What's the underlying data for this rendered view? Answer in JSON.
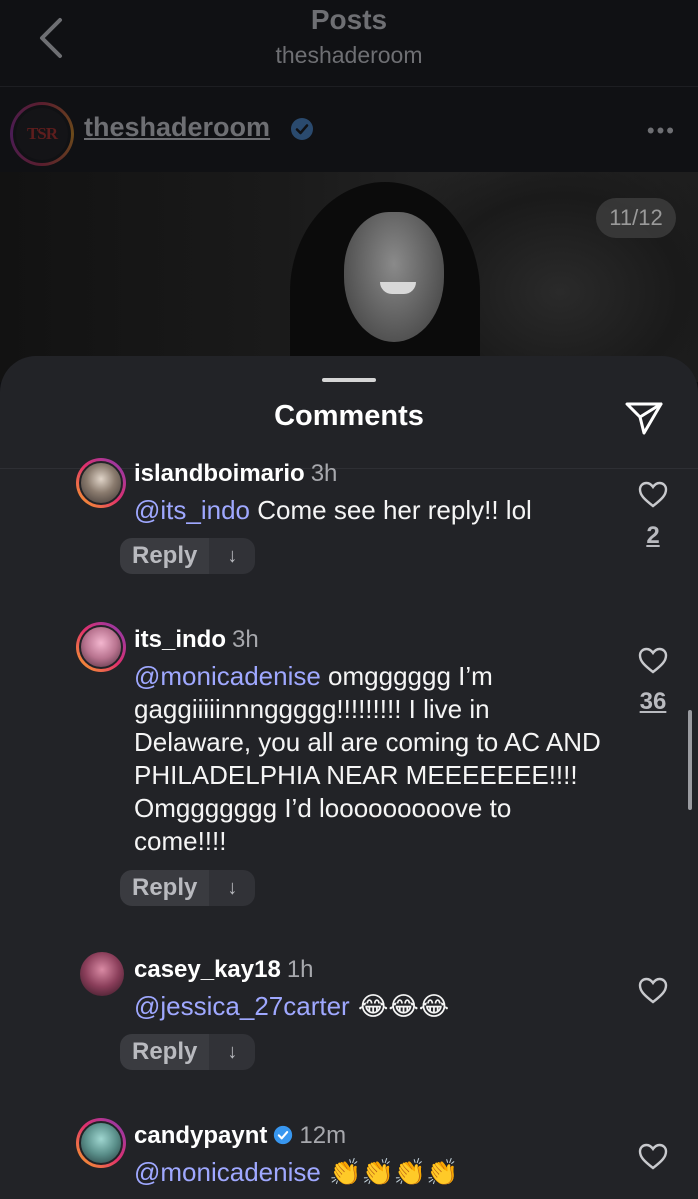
{
  "nav": {
    "title": "Posts",
    "subtitle": "theshaderoom"
  },
  "post": {
    "username": "theshaderoom",
    "verified": true,
    "avatar_logo_text": "TSR",
    "more_label": "•••",
    "image_counter": "11/12"
  },
  "sheet": {
    "title": "Comments"
  },
  "comments": [
    {
      "username": "islandboimario",
      "time": "3h",
      "mention": "@its_indo",
      "text": " Come see her reply!! lol",
      "reply_label": "Reply",
      "reply_arrow": "↓",
      "likes": "2"
    },
    {
      "username": "its_indo",
      "time": "3h",
      "mention": "@monicadenise",
      "text": " omgggggg I’m gaggiiiiinnnggggg!!!!!!!!! I live in Delaware, you all are coming to AC AND PHILADELPHIA NEAR MEEEEEEE!!!! Omggggggg I’d looooooooove to come!!!!",
      "reply_label": "Reply",
      "reply_arrow": "↓",
      "likes": "36"
    },
    {
      "username": "casey_kay18",
      "time": "1h",
      "mention": "@jessica_27carter",
      "text": " 😂😂😂",
      "reply_label": "Reply",
      "reply_arrow": "↓",
      "likes": ""
    },
    {
      "username": "candypaynt",
      "verified": true,
      "time": "12m",
      "mention": "@monicadenise",
      "text": " 👏👏👏👏",
      "likes": ""
    }
  ],
  "colors": {
    "sheet_bg": "#222327",
    "mention": "#9fa8ff",
    "verified": "#3897f0",
    "story_ring": "#e1306c"
  },
  "icons": [
    "chevron-left-icon",
    "verified-badge-icon",
    "more-icon",
    "send-icon",
    "heart-icon",
    "arrow-down-icon"
  ]
}
